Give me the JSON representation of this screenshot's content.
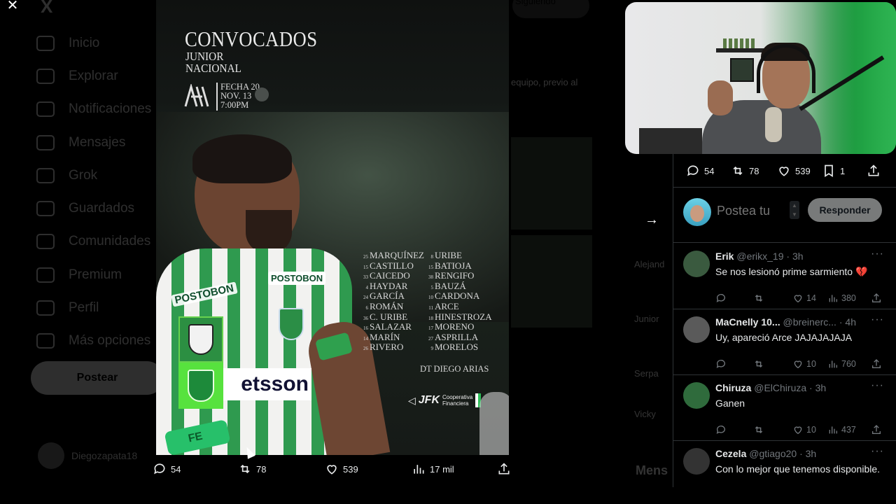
{
  "background": {
    "logo": "X",
    "nav": [
      "Inicio",
      "Explorar",
      "Notificaciones",
      "Mensajes",
      "Grok",
      "Guardados",
      "Comunidades",
      "Premium",
      "Perfil",
      "Más opciones"
    ],
    "post_button": "Postear",
    "account_name": "Diegozapata18",
    "middle": {
      "tab": "Siguiendo",
      "snippet": "equipo, previo al",
      "names": [
        "Alejand",
        "Junior",
        "Serpa",
        "Vicky"
      ],
      "side_label": "Mens"
    }
  },
  "media": {
    "title": "CONVOCADOS",
    "subtitle_lines": [
      "JUNIOR",
      "NACIONAL"
    ],
    "date_lines": [
      "FECHA 20",
      "NOV. 13",
      "7:00PM"
    ],
    "sponsor_chest_left": "POSTOBON",
    "sponsor_chest_right": "POSTOBON",
    "sponsor_front": "etsson",
    "wrist_text": "FE",
    "roster_left": [
      {
        "num": "25",
        "name": "MARQUÍNEZ"
      },
      {
        "num": "15",
        "name": "CASTILLO"
      },
      {
        "num": "33",
        "name": "CAICEDO"
      },
      {
        "num": "4",
        "name": "HAYDAR"
      },
      {
        "num": "24",
        "name": "GARCÍA"
      },
      {
        "num": "6",
        "name": "ROMÁN"
      },
      {
        "num": "36",
        "name": "C. URIBE"
      },
      {
        "num": "16",
        "name": "SALAZAR"
      },
      {
        "num": "14",
        "name": "MARÍN"
      },
      {
        "num": "26",
        "name": "RIVERO"
      }
    ],
    "roster_right": [
      {
        "num": "8",
        "name": "URIBE"
      },
      {
        "num": "15",
        "name": "BATIOJA"
      },
      {
        "num": "38",
        "name": "RENGIFO"
      },
      {
        "num": "5",
        "name": "BAUZÁ"
      },
      {
        "num": "10",
        "name": "CARDONA"
      },
      {
        "num": "11",
        "name": "ARCE"
      },
      {
        "num": "18",
        "name": "HINESTROZA"
      },
      {
        "num": "17",
        "name": "MORENO"
      },
      {
        "num": "27",
        "name": "ASPRILLA"
      },
      {
        "num": "9",
        "name": "MORELOS"
      }
    ],
    "coach": "DT DIEGO ARIAS",
    "sponsor_logo": {
      "brand": "JFK",
      "line1": "Cooperativa",
      "line2": "Financiera"
    }
  },
  "media_actions": {
    "replies": "54",
    "reposts": "78",
    "likes": "539",
    "views": "17 mil"
  },
  "stats": {
    "replies": "54",
    "reposts": "78",
    "likes": "539",
    "bookmarks": "1"
  },
  "composer": {
    "placeholder": "Postea tu",
    "reply_button": "Responder"
  },
  "replies": [
    {
      "name": "Erik",
      "handle": "@erikx_19",
      "time": "3h",
      "text": "Se nos lesionó prime sarmiento 💔",
      "replies": "",
      "reposts": "",
      "likes": "14",
      "views": "380"
    },
    {
      "name": "MaCnelly 10...",
      "handle": "@breinerc...",
      "time": "4h",
      "text": "Uy, apareció Arce JAJAJAJAJA",
      "replies": "",
      "reposts": "",
      "likes": "10",
      "views": "760"
    },
    {
      "name": "Chiruza",
      "handle": "@ElChiruza",
      "time": "3h",
      "text": "Ganen",
      "replies": "",
      "reposts": "",
      "likes": "10",
      "views": "437"
    },
    {
      "name": "Cezela",
      "handle": "@gtiago20",
      "time": "3h",
      "text": "Con lo mejor que tenemos disponible.",
      "replies": "",
      "reposts": "",
      "likes": "",
      "views": ""
    }
  ],
  "colors": {
    "accent_green": "#2f9a4f",
    "crest_green": "#57e23e",
    "muted_text": "#71767b",
    "divider": "#2f3336"
  }
}
